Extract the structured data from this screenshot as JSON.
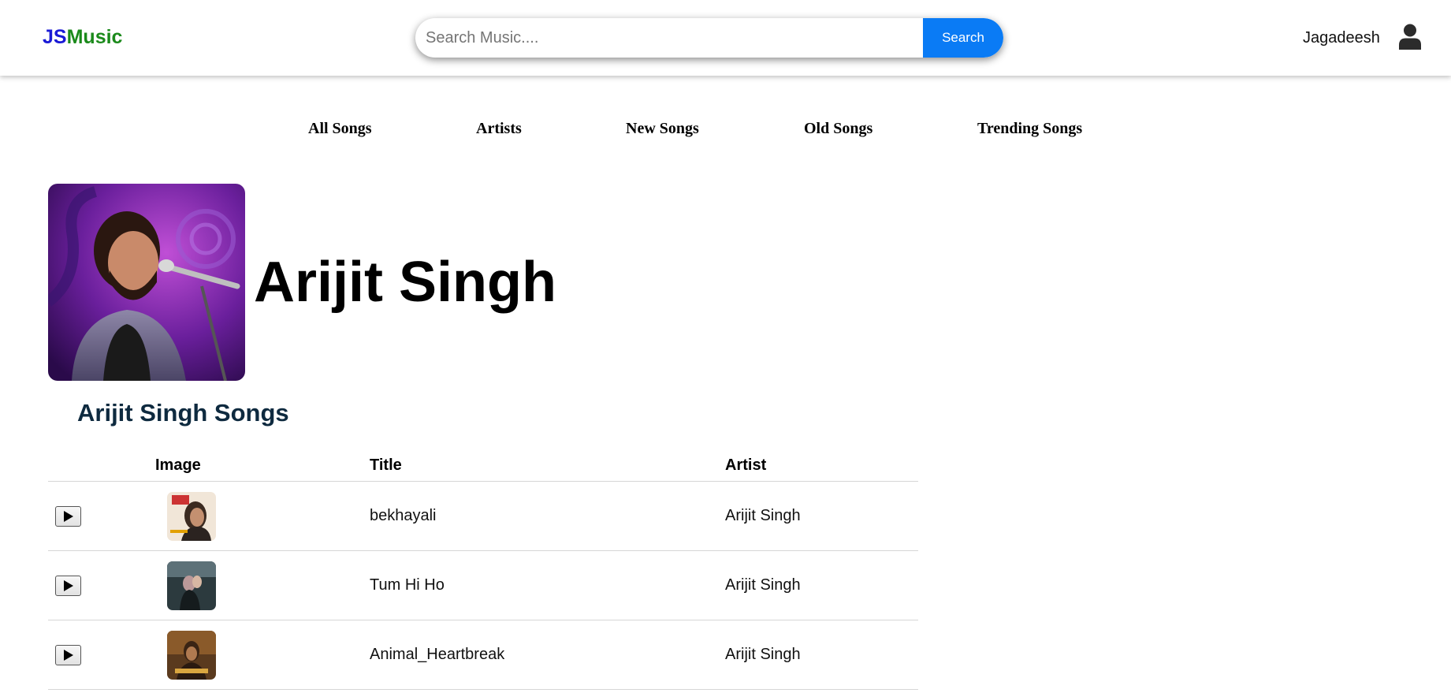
{
  "header": {
    "logo_part1": "JS",
    "logo_part2": "Music",
    "search_placeholder": "Search Music....",
    "search_value": "",
    "search_button": "Search",
    "user_name": "Jagadeesh"
  },
  "nav": {
    "items": [
      {
        "label": "All Songs"
      },
      {
        "label": "Artists"
      },
      {
        "label": "New Songs"
      },
      {
        "label": "Old Songs"
      },
      {
        "label": "Trending Songs"
      }
    ]
  },
  "artist": {
    "name": "Arijit Singh",
    "songs_heading": "Arijit Singh Songs"
  },
  "table": {
    "headers": {
      "image": "Image",
      "title": "Title",
      "artist": "Artist"
    },
    "rows": [
      {
        "title": "bekhayali",
        "artist": "Arijit Singh"
      },
      {
        "title": "Tum Hi Ho",
        "artist": "Arijit Singh"
      },
      {
        "title": "Animal_Heartbreak",
        "artist": "Arijit Singh"
      }
    ]
  },
  "colors": {
    "logo_js": "#1a1ad6",
    "logo_music": "#1b8a1b",
    "search_button_bg": "#0a7bf5",
    "songs_heading": "#0e2a3f"
  },
  "icons": [
    "user-icon",
    "play-icon"
  ]
}
